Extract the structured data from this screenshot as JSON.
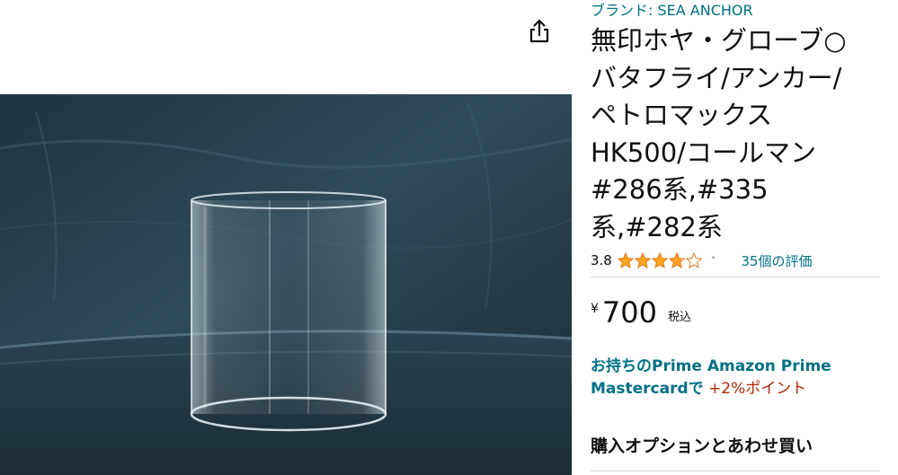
{
  "share": {
    "icon": "share-icon"
  },
  "product": {
    "brand_label": "ブランド: SEA ANCHOR",
    "title_lines": [
      "無印ホヤ・グローブ○",
      "バタフライ/アンカー/",
      "ペトロマックス",
      "HK500/コールマン",
      "#286系,#335",
      "系,#282系"
    ],
    "image_alt": "glass globe"
  },
  "rating": {
    "value": "3.8",
    "stars": 3.8,
    "max_stars": 5,
    "chevron": "˅",
    "reviews_label": "35個の評価"
  },
  "price": {
    "symbol": "¥",
    "whole": "700",
    "tax_label": "税込"
  },
  "prime": {
    "link_line1": "お持ちのPrime Amazon Prime",
    "link_line2": "Mastercardで",
    "points": "+2%ポイント"
  },
  "options": {
    "heading": "購入オプションとあわせ買い"
  },
  "colors": {
    "link": "#007185",
    "star": "#ffa41c",
    "deal": "#b12704"
  }
}
